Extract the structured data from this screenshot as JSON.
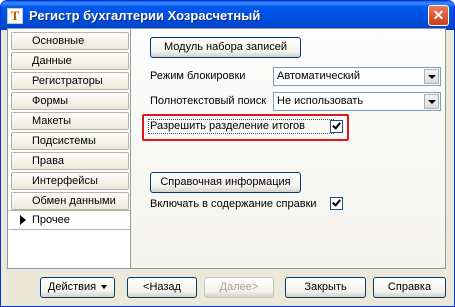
{
  "window": {
    "title": "Регистр бухгалтерии Хозрасчетный",
    "icon_glyph": "Т"
  },
  "tabs": [
    {
      "label": "Основные",
      "selected": false
    },
    {
      "label": "Данные",
      "selected": false
    },
    {
      "label": "Регистраторы",
      "selected": false
    },
    {
      "label": "Формы",
      "selected": false
    },
    {
      "label": "Макеты",
      "selected": false
    },
    {
      "label": "Подсистемы",
      "selected": false
    },
    {
      "label": "Права",
      "selected": false
    },
    {
      "label": "Интерфейсы",
      "selected": false
    },
    {
      "label": "Обмен данными",
      "selected": false
    },
    {
      "label": "Прочее",
      "selected": true
    }
  ],
  "other": {
    "record_set_module_button": "Модуль набора записей",
    "lock_mode_label": "Режим блокировки",
    "lock_mode_value": "Автоматический",
    "fulltext_label": "Полнотекстовый поиск",
    "fulltext_value": "Не использовать",
    "split_totals_label": "Разрешить разделение итогов",
    "split_totals_checked": true,
    "help_button": "Справочная информация",
    "include_help_label": "Включать в содержание справки",
    "include_help_checked": true
  },
  "footer": {
    "actions": "Действия",
    "back": "<Назад",
    "next": "Далее>",
    "close": "Закрыть",
    "help": "Справка"
  },
  "colors": {
    "highlight": "#e0191a",
    "titlebar": "#0058ee"
  }
}
